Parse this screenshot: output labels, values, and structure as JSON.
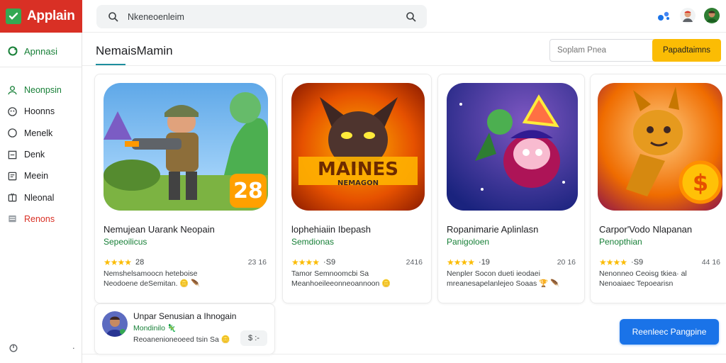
{
  "app": {
    "name": "Applain"
  },
  "sidebar": {
    "primary_label": "Apnnasi",
    "items": [
      {
        "label": "Neonpsin",
        "icon": "user-icon"
      },
      {
        "label": "Hoonns",
        "icon": "grid-icon"
      },
      {
        "label": "Menelk",
        "icon": "circle-icon"
      },
      {
        "label": "Denk",
        "icon": "square-icon"
      },
      {
        "label": "Meein",
        "icon": "message-icon"
      },
      {
        "label": "Nleonal",
        "icon": "gift-icon"
      },
      {
        "label": "Renons",
        "icon": "inbox-icon"
      }
    ],
    "bottom_left": "settings-icon",
    "bottom_right": "·"
  },
  "search": {
    "value": "Nkeneoenleim"
  },
  "section": {
    "title": "NemaisMamin",
    "filter_placeholder": "Soplam Pnea",
    "filter_button": "Papadtaimns"
  },
  "cards": [
    {
      "title": "Nemujean Uarank Neopain",
      "subtitle": "Sepeoilicus",
      "stars": "★★★★",
      "score": "28",
      "count": "23 16",
      "desc_1": "Nemshelsamoocn heteboise",
      "desc_2": "Neodoene deSemitan. 🪙 🪶"
    },
    {
      "title": "lophehiaiin Ibepash",
      "subtitle": "Semdionas",
      "stars": "★★★★",
      "score": "·S9",
      "count": "2416",
      "desc_1": "Tamor Semnoomcbi Sa",
      "desc_2": "Meanhoeileeonneoannoon 🪙"
    },
    {
      "title": "Ropanimarie Aplinlasn",
      "subtitle": "Panigoloen",
      "stars": "★★★★",
      "score": "·19",
      "count": "20 16",
      "desc_1": "Nenpler Socon dueti ieodaei",
      "desc_2": "mreanesapelanlejeo Soaas 🏆 🪶"
    },
    {
      "title": "Carpor'Vodo Nlapanan",
      "subtitle": "Penopthian",
      "stars": "★★★★",
      "score": "·S9",
      "count": "44 16",
      "desc_1": "Nenonneo Ceoisg tkiea· al",
      "desc_2": "Nenoaiaec Tepoearisn"
    }
  ],
  "review": {
    "name": "Unpar Senusian a Ihnogain",
    "handle": "Mondinilo 🦎",
    "text": "Reoanenioneoeed tsin Sa 🪙",
    "chip": "$ :-"
  },
  "cta": {
    "label": "Reenleec Pangpine"
  },
  "colors": {
    "brand": "#d93025",
    "accent_green": "#188038",
    "star": "#fbbc04",
    "cta": "#1a73e8",
    "filter_button": "#fbbc04"
  }
}
